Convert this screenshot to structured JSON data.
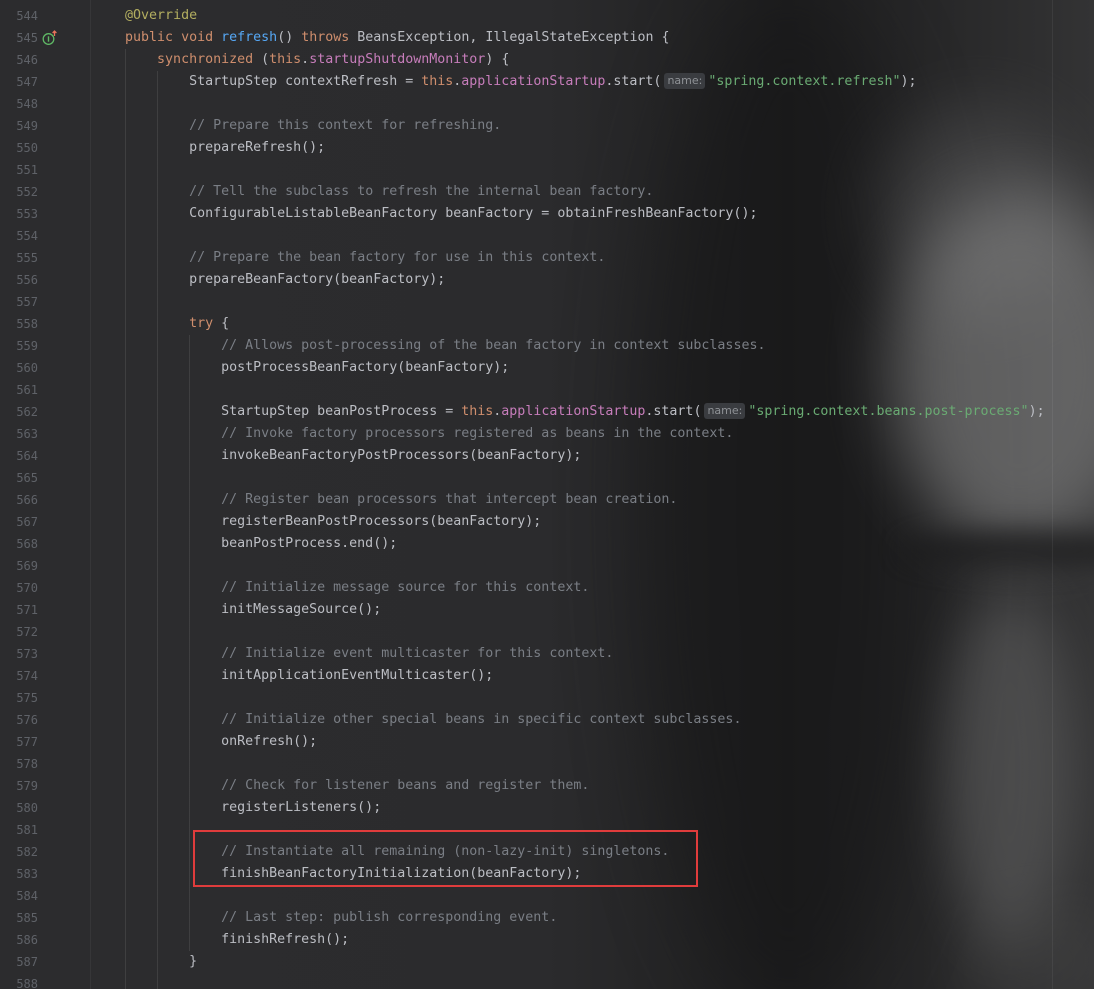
{
  "theme": {
    "text_color": "#bcbec4",
    "line_number_color": "#5f6268",
    "hint_text_color": "#8f9296",
    "hint_background": "#3a3c40",
    "highlight_border": "#e03c3c",
    "override_icon_color": "#5fb865",
    "override_arrow_color": "#e8735a"
  },
  "gutter": {
    "override_icon": "implements-method-icon"
  },
  "editor": {
    "lines": [
      {
        "number": "544",
        "tokens": [
          {
            "text": "    "
          },
          {
            "text": "@Override",
            "color": "#b3ae60"
          }
        ]
      },
      {
        "number": "545",
        "tokens": [
          {
            "text": "    "
          },
          {
            "text": "public",
            "color": "#cf8e6d"
          },
          {
            "text": " "
          },
          {
            "text": "void",
            "color": "#cf8e6d"
          },
          {
            "text": " "
          },
          {
            "text": "refresh",
            "color": "#56a8f5"
          },
          {
            "text": "() "
          },
          {
            "text": "throws",
            "color": "#cf8e6d"
          },
          {
            "text": " BeansException, IllegalStateException {"
          }
        ]
      },
      {
        "number": "546",
        "tokens": [
          {
            "text": "        "
          },
          {
            "text": "synchronized",
            "color": "#cf8e6d"
          },
          {
            "text": " ("
          },
          {
            "text": "this",
            "color": "#cf8e6d"
          },
          {
            "text": "."
          },
          {
            "text": "startupShutdownMonitor",
            "color": "#c77dbb"
          },
          {
            "text": ") {"
          }
        ]
      },
      {
        "number": "547",
        "tokens": [
          {
            "text": "            StartupStep contextRefresh = "
          },
          {
            "text": "this",
            "color": "#cf8e6d"
          },
          {
            "text": "."
          },
          {
            "text": "applicationStartup",
            "color": "#c77dbb"
          },
          {
            "text": ".start("
          },
          {
            "text": "name:",
            "hint": true
          },
          {
            "text": "\"spring.context.refresh\"",
            "color": "#6aab73"
          },
          {
            "text": ");"
          }
        ]
      },
      {
        "number": "548",
        "tokens": []
      },
      {
        "number": "549",
        "tokens": [
          {
            "text": "            "
          },
          {
            "text": "// Prepare this context for refreshing.",
            "color": "#7a7e85"
          }
        ]
      },
      {
        "number": "550",
        "tokens": [
          {
            "text": "            prepareRefresh();"
          }
        ]
      },
      {
        "number": "551",
        "tokens": []
      },
      {
        "number": "552",
        "tokens": [
          {
            "text": "            "
          },
          {
            "text": "// Tell the subclass to refresh the internal bean factory.",
            "color": "#7a7e85"
          }
        ]
      },
      {
        "number": "553",
        "tokens": [
          {
            "text": "            ConfigurableListableBeanFactory beanFactory = obtainFreshBeanFactory();"
          }
        ]
      },
      {
        "number": "554",
        "tokens": []
      },
      {
        "number": "555",
        "tokens": [
          {
            "text": "            "
          },
          {
            "text": "// Prepare the bean factory for use in this context.",
            "color": "#7a7e85"
          }
        ]
      },
      {
        "number": "556",
        "tokens": [
          {
            "text": "            prepareBeanFactory(beanFactory);"
          }
        ]
      },
      {
        "number": "557",
        "tokens": []
      },
      {
        "number": "558",
        "tokens": [
          {
            "text": "            "
          },
          {
            "text": "try",
            "color": "#cf8e6d"
          },
          {
            "text": " {"
          }
        ]
      },
      {
        "number": "559",
        "tokens": [
          {
            "text": "                "
          },
          {
            "text": "// Allows post-processing of the bean factory in context subclasses.",
            "color": "#7a7e85"
          }
        ]
      },
      {
        "number": "560",
        "tokens": [
          {
            "text": "                postProcessBeanFactory(beanFactory);"
          }
        ]
      },
      {
        "number": "561",
        "tokens": []
      },
      {
        "number": "562",
        "tokens": [
          {
            "text": "                StartupStep beanPostProcess = "
          },
          {
            "text": "this",
            "color": "#cf8e6d"
          },
          {
            "text": "."
          },
          {
            "text": "applicationStartup",
            "color": "#c77dbb"
          },
          {
            "text": ".start("
          },
          {
            "text": "name:",
            "hint": true
          },
          {
            "text": "\"spring.context.beans.post-process\"",
            "color": "#6aab73"
          },
          {
            "text": ");"
          }
        ]
      },
      {
        "number": "563",
        "tokens": [
          {
            "text": "                "
          },
          {
            "text": "// Invoke factory processors registered as beans in the context.",
            "color": "#7a7e85"
          }
        ]
      },
      {
        "number": "564",
        "tokens": [
          {
            "text": "                invokeBeanFactoryPostProcessors(beanFactory);"
          }
        ]
      },
      {
        "number": "565",
        "tokens": []
      },
      {
        "number": "566",
        "tokens": [
          {
            "text": "                "
          },
          {
            "text": "// Register bean processors that intercept bean creation.",
            "color": "#7a7e85"
          }
        ]
      },
      {
        "number": "567",
        "tokens": [
          {
            "text": "                registerBeanPostProcessors(beanFactory);"
          }
        ]
      },
      {
        "number": "568",
        "tokens": [
          {
            "text": "                beanPostProcess.end();"
          }
        ]
      },
      {
        "number": "569",
        "tokens": []
      },
      {
        "number": "570",
        "tokens": [
          {
            "text": "                "
          },
          {
            "text": "// Initialize message source for this context.",
            "color": "#7a7e85"
          }
        ]
      },
      {
        "number": "571",
        "tokens": [
          {
            "text": "                initMessageSource();"
          }
        ]
      },
      {
        "number": "572",
        "tokens": []
      },
      {
        "number": "573",
        "tokens": [
          {
            "text": "                "
          },
          {
            "text": "// Initialize event multicaster for this context.",
            "color": "#7a7e85"
          }
        ]
      },
      {
        "number": "574",
        "tokens": [
          {
            "text": "                initApplicationEventMulticaster();"
          }
        ]
      },
      {
        "number": "575",
        "tokens": []
      },
      {
        "number": "576",
        "tokens": [
          {
            "text": "                "
          },
          {
            "text": "// Initialize other special beans in specific context subclasses.",
            "color": "#7a7e85"
          }
        ]
      },
      {
        "number": "577",
        "tokens": [
          {
            "text": "                onRefresh();"
          }
        ]
      },
      {
        "number": "578",
        "tokens": []
      },
      {
        "number": "579",
        "tokens": [
          {
            "text": "                "
          },
          {
            "text": "// Check for listener beans and register them.",
            "color": "#7a7e85"
          }
        ]
      },
      {
        "number": "580",
        "tokens": [
          {
            "text": "                registerListeners();"
          }
        ]
      },
      {
        "number": "581",
        "tokens": []
      },
      {
        "number": "582",
        "tokens": [
          {
            "text": "                "
          },
          {
            "text": "// Instantiate all remaining (non-lazy-init) singletons.",
            "color": "#7a7e85"
          }
        ]
      },
      {
        "number": "583",
        "tokens": [
          {
            "text": "                finishBeanFactoryInitialization(beanFactory);"
          }
        ]
      },
      {
        "number": "584",
        "tokens": []
      },
      {
        "number": "585",
        "tokens": [
          {
            "text": "                "
          },
          {
            "text": "// Last step: publish corresponding event.",
            "color": "#7a7e85"
          }
        ]
      },
      {
        "number": "586",
        "tokens": [
          {
            "text": "                finishRefresh();"
          }
        ]
      },
      {
        "number": "587",
        "tokens": [
          {
            "text": "            }"
          }
        ]
      },
      {
        "number": "588",
        "tokens": []
      }
    ]
  }
}
